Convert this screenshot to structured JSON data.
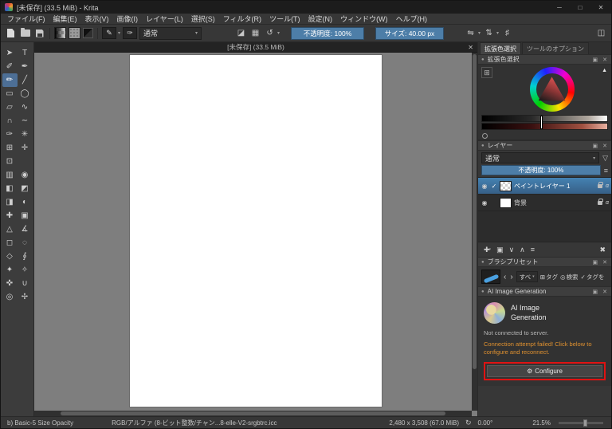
{
  "window": {
    "title": "[未保存] (33.5 MiB) - Krita",
    "minimize_icon": "─",
    "maximize_icon": "□",
    "close_icon": "✕"
  },
  "menu": {
    "items": [
      "ファイル(F)",
      "編集(E)",
      "表示(V)",
      "画像(I)",
      "レイヤー(L)",
      "選択(S)",
      "フィルタ(R)",
      "ツール(T)",
      "設定(N)",
      "ウィンドウ(W)",
      "ヘルプ(H)"
    ]
  },
  "toolbar": {
    "blend_mode": "通常",
    "dropdown_arrow": "▾",
    "brush_edit_icon": "✎",
    "brush_preset_icon": "✑",
    "eraser_icon": "◪",
    "alpha_icon": "▦",
    "reload_icon": "↺",
    "opacity_label": "不透明度: 100%",
    "size_label": "サイズ: 40.00 px",
    "mirror_h_icon": "⇋",
    "mirror_v_icon": "⇅",
    "crop_icon": "♯",
    "workspace_icon": "◫"
  },
  "toolbox": {
    "tools": [
      {
        "name": "shape-select-tool",
        "glyph": "➤"
      },
      {
        "name": "text-tool",
        "glyph": "T"
      },
      {
        "name": "edit-shapes-tool",
        "glyph": "✐"
      },
      {
        "name": "calligraphy-tool",
        "glyph": "✒"
      },
      {
        "name": "freehand-brush-tool",
        "glyph": "✏",
        "selected": true
      },
      {
        "name": "line-tool",
        "glyph": "╱"
      },
      {
        "name": "rectangle-tool",
        "glyph": "▭"
      },
      {
        "name": "ellipse-tool",
        "glyph": "◯"
      },
      {
        "name": "polygon-tool",
        "glyph": "▱"
      },
      {
        "name": "polyline-tool",
        "glyph": "∿"
      },
      {
        "name": "bezier-curve-tool",
        "glyph": "∩"
      },
      {
        "name": "freehand-path-tool",
        "glyph": "∼"
      },
      {
        "name": "dynamic-brush-tool",
        "glyph": "✑"
      },
      {
        "name": "multibrush-tool",
        "glyph": "✳"
      },
      {
        "name": "transform-tool",
        "glyph": "⊞"
      },
      {
        "name": "move-tool",
        "glyph": "✛"
      },
      {
        "name": "crop-tool",
        "glyph": "⊡"
      },
      {
        "name": "toolbox-spacer",
        "glyph": ""
      },
      {
        "name": "gradient-tool",
        "glyph": "▥"
      },
      {
        "name": "color-sampler-tool",
        "glyph": "◉"
      },
      {
        "name": "pattern-fill-tool",
        "glyph": "◧"
      },
      {
        "name": "enclose-fill-tool",
        "glyph": "◩"
      },
      {
        "name": "gradient-edit-tool",
        "glyph": "◨"
      },
      {
        "name": "colorize-mask-tool",
        "glyph": "◐"
      },
      {
        "name": "smart-patch-tool",
        "glyph": "✚"
      },
      {
        "name": "reference-images-tool",
        "glyph": "▣"
      },
      {
        "name": "assistants-tool",
        "glyph": "△"
      },
      {
        "name": "measure-tool",
        "glyph": "∡"
      },
      {
        "name": "rect-select-tool",
        "glyph": "◻"
      },
      {
        "name": "ellipse-select-tool",
        "glyph": "◌"
      },
      {
        "name": "polygon-select-tool",
        "glyph": "◇"
      },
      {
        "name": "freehand-select-tool",
        "glyph": "∮"
      },
      {
        "name": "contiguous-select-tool",
        "glyph": "✦"
      },
      {
        "name": "similar-select-tool",
        "glyph": "✧"
      },
      {
        "name": "bezier-select-tool",
        "glyph": "✜"
      },
      {
        "name": "magnetic-select-tool",
        "glyph": "∪"
      },
      {
        "name": "zoom-tool",
        "glyph": "◎"
      },
      {
        "name": "pan-tool",
        "glyph": "✢"
      }
    ]
  },
  "canvas": {
    "tab_title": "[未保存] (33.5 MiB)",
    "close_icon": "✕"
  },
  "dockers": {
    "tabs": {
      "color_selector": "拡張色選択",
      "tool_options": "ツールのオプション"
    },
    "common": {
      "dot_icon": "●",
      "float_icon": "▣",
      "close_icon": "✕"
    },
    "color_selector": {
      "title": "拡張色選択",
      "shade_icon": "⊞",
      "gamut_icon": "▲",
      "history_icon": "◯"
    },
    "layers": {
      "title": "レイヤー",
      "blend_mode": "通常",
      "dropdown_arrow": "▾",
      "filter_icon": "▽",
      "opacity_label": "不透明度: 100%",
      "props_icon": "≡",
      "items": [
        {
          "eye": "◉",
          "check": "✓",
          "name": "ペイントレイヤー 1",
          "alpha": "α",
          "selected": true,
          "thumb_transparent": true
        },
        {
          "eye": "◉",
          "check": "",
          "name": "背景",
          "alpha": "α",
          "selected": false,
          "thumb_transparent": false
        }
      ],
      "buttons": {
        "add": "✚",
        "add_arrow": "▾",
        "duplicate": "▣",
        "down": "∨",
        "up": "∧",
        "props": "≡",
        "delete": "✖"
      }
    },
    "brush_presets": {
      "title": "ブラシプリセット",
      "prev_icon": "‹",
      "next_icon": "›",
      "filter_label": "すべ",
      "dropdown_arrow": "▾",
      "tag_icon": "⊞",
      "tag_label": "タグ",
      "search_icon": "◎",
      "search_label": "検索",
      "check_icon": "✓",
      "tags_toggle_label": "タグを"
    },
    "ai": {
      "title": "AI Image Generation",
      "logo_title": "AI Image Generation",
      "status": "Not connected to server.",
      "warning": "Connection attempt failed! Click below to configure and reconnect.",
      "configure_icon": "⚙",
      "configure_label": "Configure"
    }
  },
  "statusbar": {
    "brush_info": "b) Basic-5 Size Opacity",
    "color_profile": "RGB/アルファ (8-ビット整数/チャン...8-elle-V2-srgbtrc.icc",
    "dimensions": "2,480 x 3,508 (67.0 MiB)",
    "rotation_icon": "↻",
    "angle": "0.00°",
    "zoom": "21.5%"
  },
  "colors": {
    "accent_blue": "#4d7ea8",
    "selection_blue": "#3d6e99",
    "warning_orange": "#e0912f",
    "highlight_red": "#e01212",
    "canvas_gray": "#7e7e7e"
  }
}
